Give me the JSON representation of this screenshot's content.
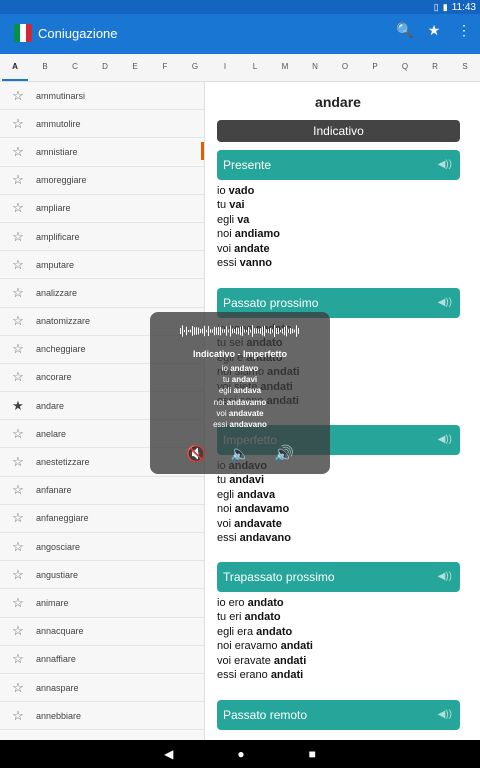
{
  "status": {
    "time": "11:43",
    "icons": [
      "vibrate-icon",
      "battery-icon"
    ]
  },
  "app": {
    "title": "Coniugazione",
    "flag_colors": [
      "#009246",
      "#ffffff",
      "#ce2b37"
    ],
    "actions": [
      "search-icon",
      "star-icon",
      "overflow-icon"
    ]
  },
  "letters": [
    "A",
    "B",
    "C",
    "D",
    "E",
    "F",
    "G",
    "I",
    "L",
    "M",
    "N",
    "O",
    "P",
    "Q",
    "R",
    "S"
  ],
  "active_letter": "A",
  "verbs": [
    {
      "label": "ammutinarsi",
      "starred": false
    },
    {
      "label": "ammutolire",
      "starred": false
    },
    {
      "label": "amnistiare",
      "starred": false
    },
    {
      "label": "amoreggiare",
      "starred": false
    },
    {
      "label": "ampliare",
      "starred": false
    },
    {
      "label": "amplificare",
      "starred": false
    },
    {
      "label": "amputare",
      "starred": false
    },
    {
      "label": "analizzare",
      "starred": false
    },
    {
      "label": "anatomizzare",
      "starred": false
    },
    {
      "label": "ancheggiare",
      "starred": false
    },
    {
      "label": "ancorare",
      "starred": false
    },
    {
      "label": "andare",
      "starred": true
    },
    {
      "label": "anelare",
      "starred": false
    },
    {
      "label": "anestetizzare",
      "starred": false
    },
    {
      "label": "anfanare",
      "starred": false
    },
    {
      "label": "anfaneggiare",
      "starred": false
    },
    {
      "label": "angosciare",
      "starred": false
    },
    {
      "label": "angustiare",
      "starred": false
    },
    {
      "label": "animare",
      "starred": false
    },
    {
      "label": "annacquare",
      "starred": false
    },
    {
      "label": "annaffiare",
      "starred": false
    },
    {
      "label": "annaspare",
      "starred": false
    },
    {
      "label": "annebbiare",
      "starred": false
    }
  ],
  "detail": {
    "verb": "andare",
    "mood": "Indicativo",
    "tenses": [
      {
        "name": "Presente",
        "lines": [
          [
            "io",
            "vado"
          ],
          [
            "tu",
            "vai"
          ],
          [
            "egli",
            "va"
          ],
          [
            "noi",
            "andiamo"
          ],
          [
            "voi",
            "andate"
          ],
          [
            "essi",
            "vanno"
          ]
        ]
      },
      {
        "name": "Passato prossimo",
        "lines": [
          [
            "io sono",
            "andato"
          ],
          [
            "tu sei",
            "andato"
          ],
          [
            "egli è",
            "andato"
          ],
          [
            "noi siamo",
            "andati"
          ],
          [
            "voi siete",
            "andati"
          ],
          [
            "essi sono",
            "andati"
          ]
        ]
      },
      {
        "name": "Imperfetto",
        "lines": [
          [
            "io",
            "andavo"
          ],
          [
            "tu",
            "andavi"
          ],
          [
            "egli",
            "andava"
          ],
          [
            "noi",
            "andavamo"
          ],
          [
            "voi",
            "andavate"
          ],
          [
            "essi",
            "andavano"
          ]
        ]
      },
      {
        "name": "Trapassato prossimo",
        "lines": [
          [
            "io ero",
            "andato"
          ],
          [
            "tu eri",
            "andato"
          ],
          [
            "egli era",
            "andato"
          ],
          [
            "noi eravamo",
            "andati"
          ],
          [
            "voi eravate",
            "andati"
          ],
          [
            "essi erano",
            "andati"
          ]
        ]
      },
      {
        "name": "Passato remoto",
        "lines": []
      }
    ]
  },
  "overlay": {
    "title": "Indicativo - Imperfetto",
    "lines": [
      [
        "io",
        "andavo"
      ],
      [
        "tu",
        "andavi"
      ],
      [
        "egli",
        "andava"
      ],
      [
        "noi",
        "andavamo"
      ],
      [
        "voi",
        "andavate"
      ],
      [
        "essi",
        "andavano"
      ]
    ],
    "controls": [
      "mute-icon",
      "volume-low-icon",
      "volume-high-icon"
    ]
  },
  "nav": [
    "back-icon",
    "home-icon",
    "recents-icon"
  ]
}
